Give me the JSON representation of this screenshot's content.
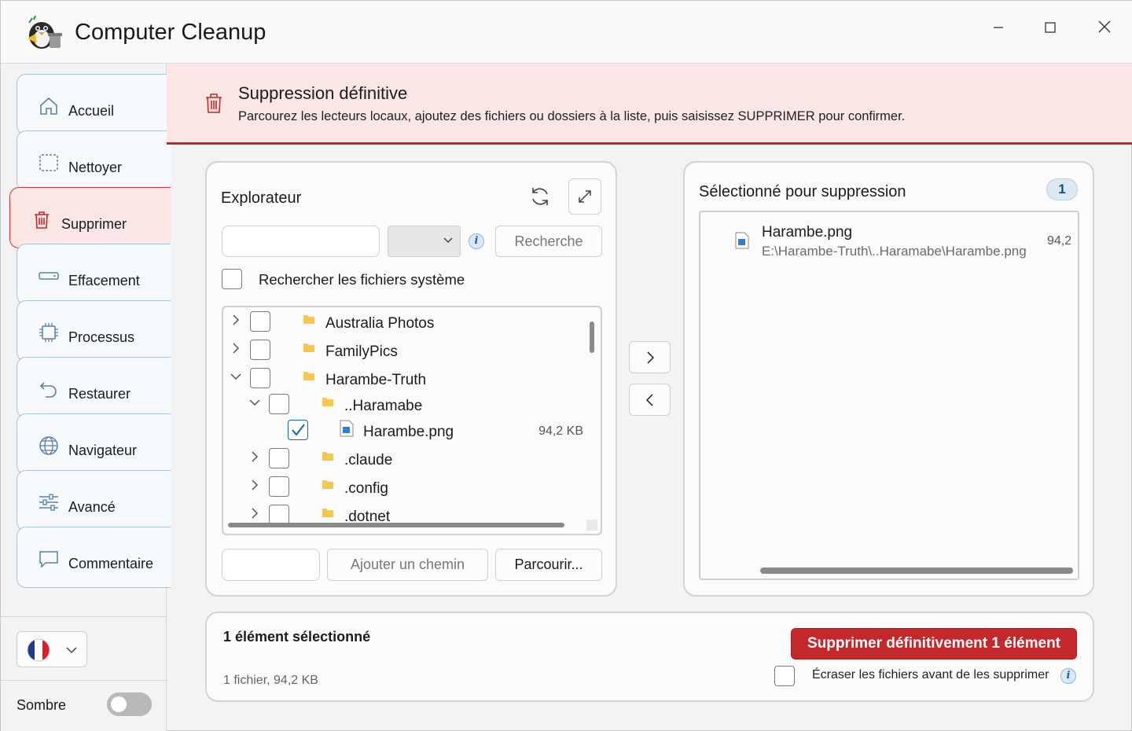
{
  "app": {
    "title": "Computer Cleanup",
    "logo_icon": "penguin-trash-logo"
  },
  "window_controls": {
    "minimize": "–",
    "maximize": "☐",
    "close": "✕"
  },
  "sidebar": {
    "items": [
      {
        "label": "Accueil",
        "icon": "home-icon"
      },
      {
        "label": "Nettoyer",
        "icon": "clean-icon"
      },
      {
        "label": "Supprimer",
        "icon": "trash-icon",
        "active": true
      },
      {
        "label": "Effacement",
        "icon": "drive-icon"
      },
      {
        "label": "Processus",
        "icon": "chip-icon"
      },
      {
        "label": "Restaurer",
        "icon": "restore-icon"
      },
      {
        "label": "Navigateur",
        "icon": "globe-icon"
      },
      {
        "label": "Avancé",
        "icon": "sliders-icon"
      },
      {
        "label": "Commentaire",
        "icon": "comment-icon"
      }
    ],
    "language": "FR",
    "dark_mode_label": "Sombre",
    "dark_mode_on": false
  },
  "banner": {
    "title": "Suppression définitive",
    "description": "Parcourez les lecteurs locaux, ajoutez des fichiers ou dossiers à la liste, puis saisissez SUPPRIMER pour confirmer.",
    "accent": "#c4282b"
  },
  "explorer": {
    "title": "Explorateur",
    "search_value": "",
    "search_button": "Recherche",
    "system_files_label": "Rechercher les fichiers système",
    "tree": [
      {
        "name": "Australia Photos",
        "level": 0,
        "expanded": false,
        "type": "folder",
        "checked": false
      },
      {
        "name": "FamilyPics",
        "level": 0,
        "expanded": false,
        "type": "folder",
        "checked": false
      },
      {
        "name": "Harambe-Truth",
        "level": 0,
        "expanded": true,
        "type": "folder",
        "checked": false
      },
      {
        "name": "..Haramabe",
        "level": 1,
        "expanded": true,
        "type": "folder",
        "checked": false
      },
      {
        "name": "Harambe.png",
        "level": 2,
        "type": "file",
        "checked": true,
        "size": "94,2 KB"
      },
      {
        "name": ".claude",
        "level": 1,
        "expanded": false,
        "type": "folder",
        "checked": false
      },
      {
        "name": ".config",
        "level": 1,
        "expanded": false,
        "type": "folder",
        "checked": false
      },
      {
        "name": ".dotnet",
        "level": 1,
        "expanded": false,
        "type": "folder",
        "checked": false
      }
    ],
    "add_path_button": "Ajouter un chemin",
    "browse_button": "Parcourir..."
  },
  "selected": {
    "title": "Sélectionné pour suppression",
    "count": "1",
    "items": [
      {
        "name": "Harambe.png",
        "path": "E:\\Harambe-Truth\\..Haramabe\\Harambe.png",
        "size": "94,2"
      }
    ]
  },
  "summary": {
    "title": "1 élément sélectionné",
    "subtitle": "1 fichier, 94,2 KB",
    "delete_button": "Supprimer définitivement 1 élément",
    "overwrite_label": "Écraser les fichiers avant de les supprimer"
  }
}
